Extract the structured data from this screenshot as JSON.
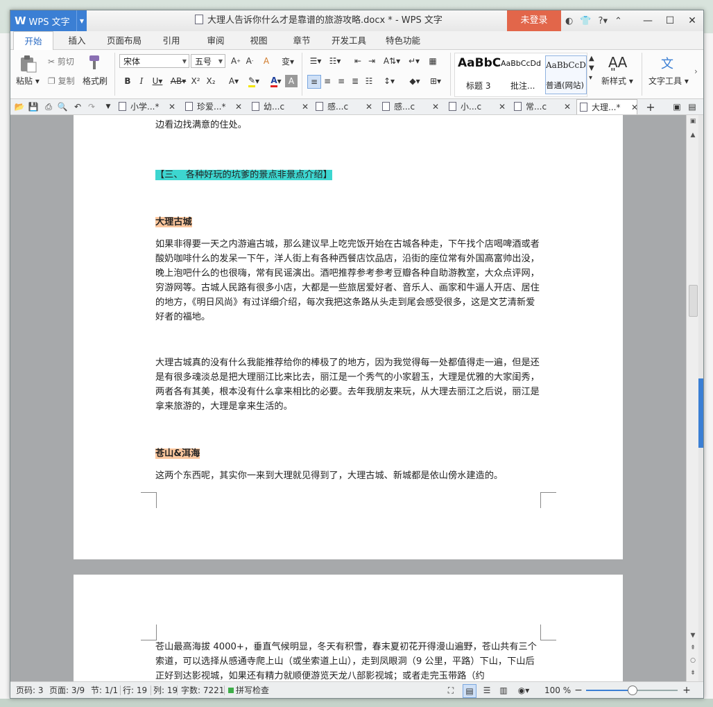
{
  "window": {
    "app_name": "WPS 文字",
    "title": "大理人告诉你什么才是靠谱的旅游攻略.docx * - WPS 文字",
    "login_label": "未登录",
    "help_label": "?"
  },
  "ribbon_tabs": [
    "开始",
    "插入",
    "页面布局",
    "引用",
    "审阅",
    "视图",
    "章节",
    "开发工具",
    "特色功能"
  ],
  "active_tab": "开始",
  "ribbon": {
    "paste_label": "粘贴",
    "cut_label": "剪切",
    "copy_label": "复制",
    "format_painter_label": "格式刷",
    "font_name": "宋体",
    "font_size": "五号",
    "styles": [
      {
        "preview": "AaBbC",
        "name": "标题 3"
      },
      {
        "preview": "AaBbCcDd",
        "name": "批注..."
      },
      {
        "preview": "AaBbCcDd",
        "name": "普通(网站)"
      }
    ],
    "new_style_label": "新样式",
    "text_tools_label": "文字工具"
  },
  "doc_tabs": [
    {
      "label": "小学...*"
    },
    {
      "label": "珍爱...*"
    },
    {
      "label": "幼...c"
    },
    {
      "label": "感...c"
    },
    {
      "label": "感...c"
    },
    {
      "label": "小...c"
    },
    {
      "label": "常...c"
    },
    {
      "label": "大理...*"
    }
  ],
  "document": {
    "top_fragment": "边看边找满意的住处。",
    "section_heading": "【三、    各种好玩的坑爹的景点非景点介绍】",
    "heading1": "大理古城",
    "para1": "如果非得要一天之内游遍古城，那么建议早上吃完饭开始在古城各种走，下午找个店喝啤酒或者酸奶咖啡什么的发呆一下午，洋人街上有各种西餐店饮品店，沿街的座位常有外国高富帅出没，晚上泡吧什么的也很嗨，常有民谣演出。酒吧推荐参考参考豆瓣各种自助游教室，大众点评网，穷游网等。古城人民路有很多小店，大都是一些旅居爱好者、音乐人、画家和牛逼人开店、居住的地方，《明日风尚》有过详细介绍，每次我把这条路从头走到尾会感受很多，这是文艺清新爱好者的福地。",
    "para2": "大理古城真的没有什么我能推荐给你的棒极了的地方，因为我觉得每一处都值得走一遍，但是还是有很多魂淡总是把大理丽江比来比去，丽江是一个秀气的小家碧玉，大理是优雅的大家闺秀，两者各有其美，根本没有什么拿来相比的必要。去年我朋友来玩，从大理去丽江之后说，丽江是拿来旅游的，大理是拿来生活的。",
    "heading2": "苍山&洱海",
    "para3": "这两个东西呢，其实你一来到大理就见得到了，大理古城、新城都是依山傍水建造的。",
    "para4": "苍山最高海拔 4000+，垂直气候明显，冬天有积雪，春末夏初花开得漫山遍野，苍山共有三个索道，可以选择从感通寺爬上山（或坐索道上山），走到凤眼洞（9 公里，平路）下山，下山后正好到达影视城，如果还有精力就顺便游览天龙八部影视城；或者走完玉带路（约"
  },
  "status": {
    "page_no": "页码: 3",
    "pages": "页面: 3/9",
    "section": "节: 1/1",
    "row": "行: 19",
    "col": "列: 19",
    "word_count": "字数: 7221",
    "spell_check": "拼写检查",
    "zoom": "100 %"
  },
  "zoom_level_fraction": 0.5,
  "colors": {
    "accent": "#3b7fd4",
    "login": "#e2664a",
    "highlight_cyan": "#3dd6d0",
    "highlight_peach": "#fcc79e"
  }
}
